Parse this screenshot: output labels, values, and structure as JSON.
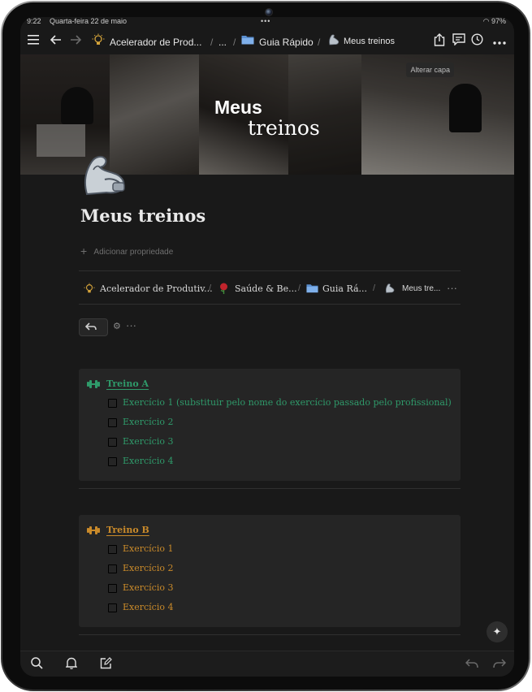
{
  "status": {
    "time": "9:22",
    "date": "Quarta-feira 22 de maio",
    "battery": "97%"
  },
  "topbar": {
    "crumb1": "Acelerador de Prod...",
    "crumb2": "...",
    "crumb3": "Guia Rápido",
    "crumb4": "Meus treinos"
  },
  "cover": {
    "title_line1": "Meus",
    "title_line2": "treinos",
    "change_label": "Alterar capa"
  },
  "page": {
    "title": "Meus treinos",
    "add_property": "Adicionar propriedade"
  },
  "breadcrumb": {
    "item1": "Acelerador de Produtiv...",
    "item2": "Saúde & Be...",
    "item3": "Guia Rá...",
    "item4": "Meus tre..."
  },
  "workouts": [
    {
      "title": "Treino A",
      "color": "#2f9a6a",
      "items": [
        "Exercício 1 (substituir pelo nome do exercício passado pelo profissional)",
        "Exercício 2",
        "Exercício 3",
        "Exercício 4"
      ]
    },
    {
      "title": "Treino B",
      "color": "#c98a2a",
      "items": [
        "Exercício 1",
        "Exercício 2",
        "Exercício 3",
        "Exercício 4"
      ]
    }
  ]
}
